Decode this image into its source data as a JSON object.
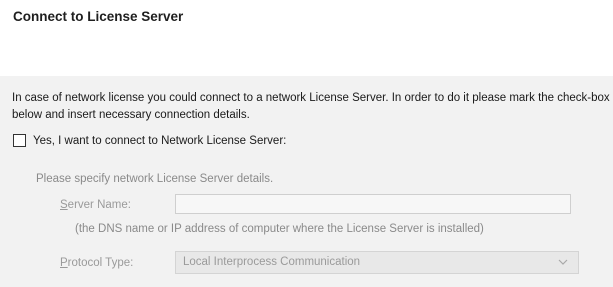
{
  "header": {
    "title": "Connect to License Server"
  },
  "content": {
    "description": "In case of network license you could connect to a network License Server. In order to do it please mark the check-box below and insert necessary connection details.",
    "checkbox_label": "Yes, I want to connect to Network License Server:",
    "checkbox_checked": false,
    "hint": "Please specify network License Server details.",
    "server_name": {
      "label_access_key": "S",
      "label_rest": "erver Name:",
      "value": "",
      "note": "(the DNS name or IP address of computer where the License Server is installed)"
    },
    "protocol_type": {
      "label_access_key": "P",
      "label_rest": "rotocol Type:",
      "selected": "Local Interprocess Communication",
      "icon": "chevron-down-icon"
    }
  },
  "colors": {
    "header_bg": "#ffffff",
    "panel_bg": "#f2f2f2",
    "disabled_text": "#9a9a9a"
  }
}
